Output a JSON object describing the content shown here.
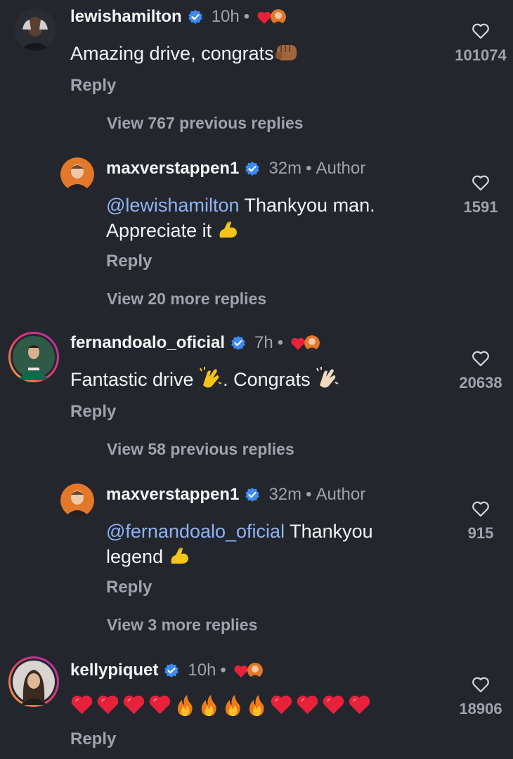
{
  "comments": [
    {
      "username": "lewishamilton",
      "time": "10h",
      "text": "Amazing drive, congrats",
      "reply": "Reply",
      "likes": "101074",
      "view_replies": "View 767 previous replies"
    },
    {
      "username": "maxverstappen1",
      "time": "32m",
      "author": "Author",
      "mention": "@lewishamilton",
      "text": " Thankyou man.",
      "text2": "Appreciate it",
      "reply": "Reply",
      "likes": "1591",
      "view_replies": "View 20 more replies"
    },
    {
      "username": "fernandoalo_oficial",
      "time": "7h",
      "text": "Fantastic drive",
      "text_b": ". Congrats",
      "reply": "Reply",
      "likes": "20638",
      "view_replies": "View 58 previous replies"
    },
    {
      "username": "maxverstappen1",
      "time": "32m",
      "author": "Author",
      "mention": "@fernandoalo_oficial",
      "text": " Thankyou",
      "text2": "legend",
      "reply": "Reply",
      "likes": "915",
      "view_replies": "View 3 more replies"
    },
    {
      "username": "kellypiquet",
      "time": "10h",
      "emoji_sequence": [
        "red-heart",
        "red-heart",
        "red-heart",
        "red-heart",
        "fire",
        "fire",
        "fire",
        "fire",
        "red-heart",
        "red-heart",
        "red-heart",
        "red-heart"
      ],
      "reply": "Reply",
      "likes": "18906"
    }
  ],
  "colors": {
    "background": "#24262e",
    "secondary_text": "#a0a3ab",
    "mention": "#8fb3f2",
    "verified": "#3d8bf2",
    "heart_red": "#e8213b"
  }
}
